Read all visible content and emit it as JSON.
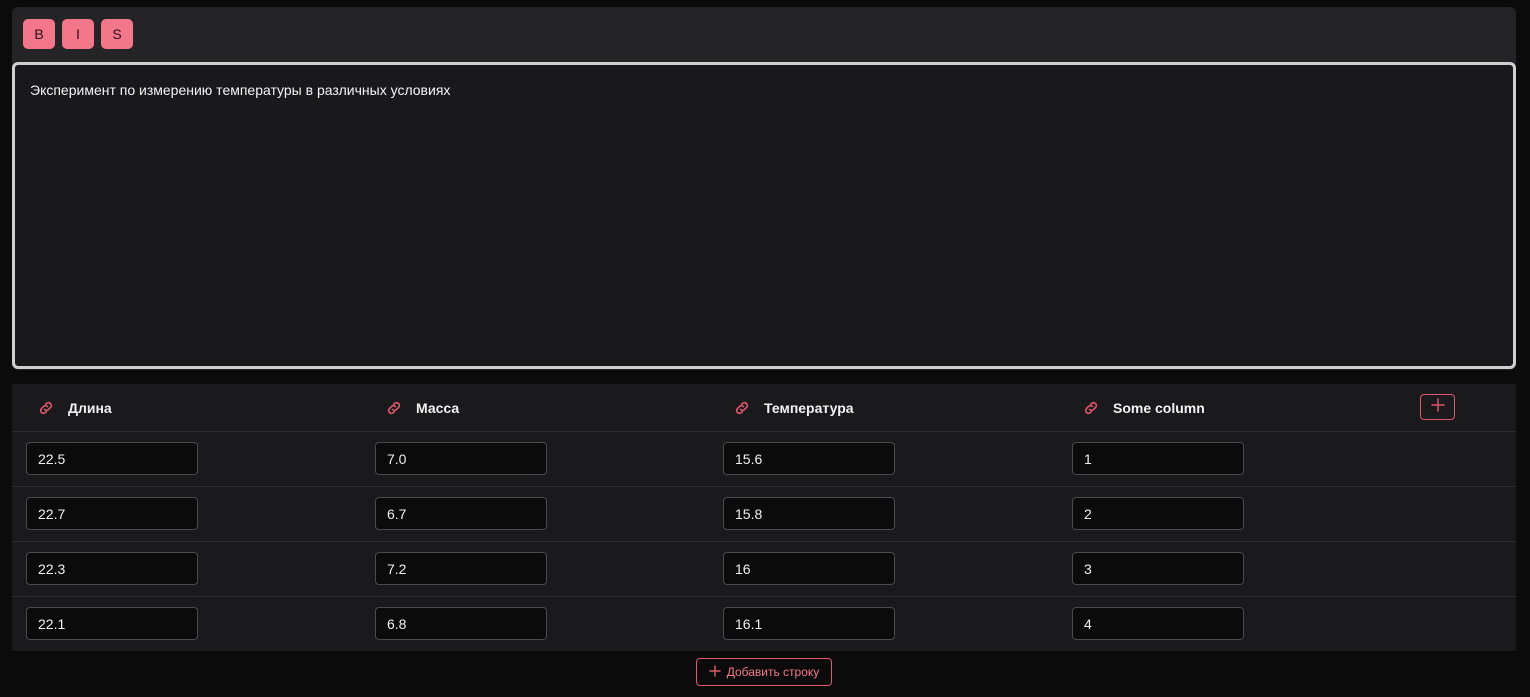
{
  "toolbar": {
    "bold": "B",
    "italic": "I",
    "strike": "S"
  },
  "editor": {
    "text": "Эксперимент по измерению температуры в различных условиях"
  },
  "table": {
    "columns": [
      "Длина",
      "Масса",
      "Температура",
      "Some column"
    ],
    "rows": [
      [
        "22.5",
        "7.0",
        "15.6",
        "1"
      ],
      [
        "22.7",
        "6.7",
        "15.8",
        "2"
      ],
      [
        "22.3",
        "7.2",
        "16",
        "3"
      ],
      [
        "22.1",
        "6.8",
        "16.1",
        "4"
      ]
    ]
  },
  "add_row_label": "Добавить строку",
  "colors": {
    "accent": "#f4768a",
    "accent_border": "#e0566c",
    "background": "#0b0b0c"
  },
  "icons": {
    "column_link": "link-icon",
    "add_column": "plus-icon",
    "add_row": "plus-icon"
  }
}
